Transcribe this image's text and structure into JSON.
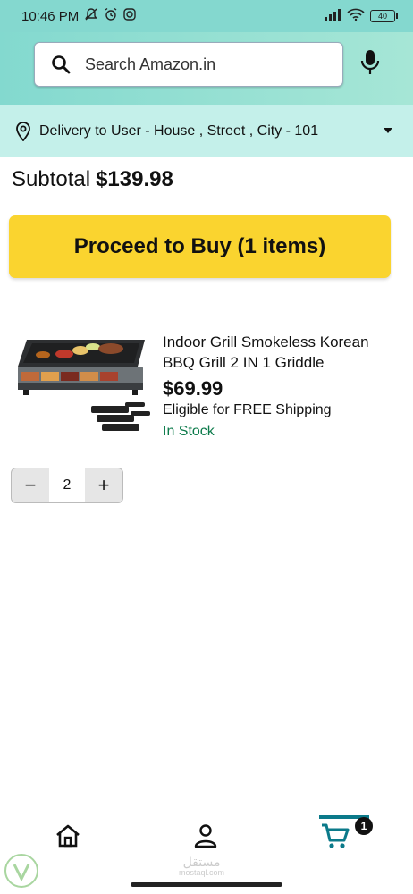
{
  "status_bar": {
    "time": "10:46 PM",
    "battery": "40"
  },
  "search": {
    "placeholder": "Search Amazon.in"
  },
  "delivery": {
    "text": "Delivery to User - House , Street , City  - 101"
  },
  "cart": {
    "subtotal_label": "Subtotal",
    "subtotal_amount": "$139.98",
    "proceed_button": "Proceed to Buy (1 items)",
    "badge_count": "1"
  },
  "product": {
    "title": "Indoor Grill Smokeless Korean BBQ Grill 2 IN 1 Griddle",
    "price": "$69.99",
    "shipping": "Eligible for FREE Shipping",
    "stock": "In Stock",
    "quantity": "2"
  },
  "stepper": {
    "minus": "−",
    "plus": "+"
  },
  "watermark": {
    "text": "مستقل",
    "sub": "mostaql.com"
  },
  "colors": {
    "header": "#84d8cf",
    "delivery_bg": "#c4f0ea",
    "buy_button": "#fad42f",
    "in_stock": "#0b7a4a",
    "cart_accent": "#0b7a8a"
  },
  "icons": [
    "search-icon",
    "mic-icon",
    "location-pin-icon",
    "chevron-down-icon",
    "home-icon",
    "account-icon",
    "cart-icon"
  ]
}
